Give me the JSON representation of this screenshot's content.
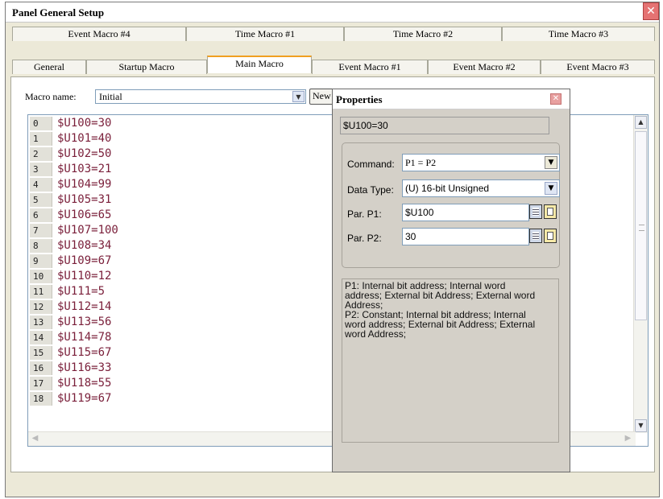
{
  "window": {
    "title": "Panel General Setup",
    "close_glyph": "✕"
  },
  "tabs_top": [
    "Event Macro #4",
    "Time Macro #1",
    "Time Macro #2",
    "Time Macro #3"
  ],
  "tabs_bottom": [
    "General",
    "Startup Macro",
    "Main Macro",
    "Event Macro #1",
    "Event Macro #2",
    "Event Macro #3"
  ],
  "active_tab": "Main Macro",
  "macro": {
    "name_label": "Macro name:",
    "name_value": "Initial",
    "new_button": "New"
  },
  "editor_lines": [
    {
      "num": "0",
      "code": "$U100=30"
    },
    {
      "num": "1",
      "code": "$U101=40"
    },
    {
      "num": "2",
      "code": "$U102=50"
    },
    {
      "num": "3",
      "code": "$U103=21"
    },
    {
      "num": "4",
      "code": "$U104=99"
    },
    {
      "num": "5",
      "code": "$U105=31"
    },
    {
      "num": "6",
      "code": "$U106=65"
    },
    {
      "num": "7",
      "code": "$U107=100"
    },
    {
      "num": "8",
      "code": "$U108=34"
    },
    {
      "num": "9",
      "code": "$U109=67"
    },
    {
      "num": "10",
      "code": "$U110=12"
    },
    {
      "num": "11",
      "code": "$U111=5"
    },
    {
      "num": "12",
      "code": "$U112=14"
    },
    {
      "num": "13",
      "code": "$U113=56"
    },
    {
      "num": "14",
      "code": "$U114=78"
    },
    {
      "num": "15",
      "code": "$U115=67"
    },
    {
      "num": "16",
      "code": "$U116=33"
    },
    {
      "num": "17",
      "code": "$U118=55"
    },
    {
      "num": "18",
      "code": "$U119=67"
    }
  ],
  "properties": {
    "title": "Properties",
    "preview": "$U100=30",
    "command_label": "Command:",
    "command_value": "P1 = P2",
    "datatype_label": "Data Type:",
    "datatype_value": "(U) 16-bit Unsigned",
    "p1_label": "Par. P1:",
    "p1_value": "$U100",
    "p2_label": "Par. P2:",
    "p2_value": "30",
    "description": "P1: Internal bit address; Internal word\naddress; External bit Address; External word\nAddress;\nP2: Constant; Internal bit address; Internal\nword address; External bit Address; External\nword Address;"
  }
}
